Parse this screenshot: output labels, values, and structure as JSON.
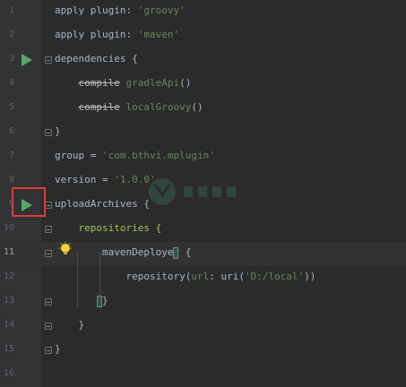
{
  "editor": {
    "lines": [
      {
        "num": "1",
        "tokens": [
          {
            "t": "apply plugin: ",
            "c": "plain"
          },
          {
            "t": "'groovy'",
            "c": "str"
          }
        ]
      },
      {
        "num": "2",
        "tokens": [
          {
            "t": "apply plugin: ",
            "c": "plain"
          },
          {
            "t": "'maven'",
            "c": "str"
          }
        ]
      },
      {
        "num": "3",
        "tokens": [
          {
            "t": "dependencies {",
            "c": "plain"
          }
        ]
      },
      {
        "num": "4",
        "tokens": [
          {
            "t": "    ",
            "c": "plain"
          },
          {
            "t": "compile",
            "c": "strike"
          },
          {
            "t": " gradleApi",
            "c": "dep"
          },
          {
            "t": "()",
            "c": "plain"
          }
        ]
      },
      {
        "num": "5",
        "tokens": [
          {
            "t": "    ",
            "c": "plain"
          },
          {
            "t": "compile",
            "c": "strike"
          },
          {
            "t": " localGroovy",
            "c": "dep"
          },
          {
            "t": "()",
            "c": "plain"
          }
        ]
      },
      {
        "num": "6",
        "tokens": [
          {
            "t": "}",
            "c": "plain"
          }
        ]
      },
      {
        "num": "7",
        "tokens": [
          {
            "t": "group = ",
            "c": "plain"
          },
          {
            "t": "'com.bthvi.mplugin'",
            "c": "str"
          }
        ]
      },
      {
        "num": "8",
        "tokens": [
          {
            "t": "version = ",
            "c": "plain"
          },
          {
            "t": "'1.0.0'",
            "c": "str"
          }
        ]
      },
      {
        "num": "9",
        "tokens": [
          {
            "t": "uploadArchives {",
            "c": "plain"
          }
        ]
      },
      {
        "num": "10",
        "tokens": [
          {
            "t": "    repositories {",
            "c": "green"
          }
        ]
      },
      {
        "num": "11",
        "tokens": [
          {
            "t": "        mavenDeployer {",
            "c": "plain"
          }
        ]
      },
      {
        "num": "12",
        "tokens": [
          {
            "t": "            repository(",
            "c": "plain"
          },
          {
            "t": "url",
            "c": "dep"
          },
          {
            "t": ": uri(",
            "c": "plain"
          },
          {
            "t": "'D:/local'",
            "c": "str"
          },
          {
            "t": "))",
            "c": "plain"
          }
        ]
      },
      {
        "num": "13",
        "tokens": [
          {
            "t": "        }",
            "c": "plain"
          }
        ]
      },
      {
        "num": "14",
        "tokens": [
          {
            "t": "    }",
            "c": "plain"
          }
        ]
      },
      {
        "num": "15",
        "tokens": [
          {
            "t": "}",
            "c": "plain"
          }
        ]
      },
      {
        "num": "16",
        "tokens": []
      }
    ],
    "current_line": "11",
    "run_lines": [
      "3",
      "9"
    ],
    "fold_lines": [
      "3",
      "6",
      "9",
      "10",
      "11",
      "13",
      "14",
      "15"
    ],
    "highlighted_run": "9"
  },
  "icons": {
    "run": "run-gutter-icon",
    "bulb": "intention-bulb-icon",
    "fold": "fold-marker-icon"
  },
  "colors": {
    "background": "#2b2b2b",
    "gutter": "#313335",
    "run_green": "#59a869",
    "highlight_box": "#e53935"
  }
}
